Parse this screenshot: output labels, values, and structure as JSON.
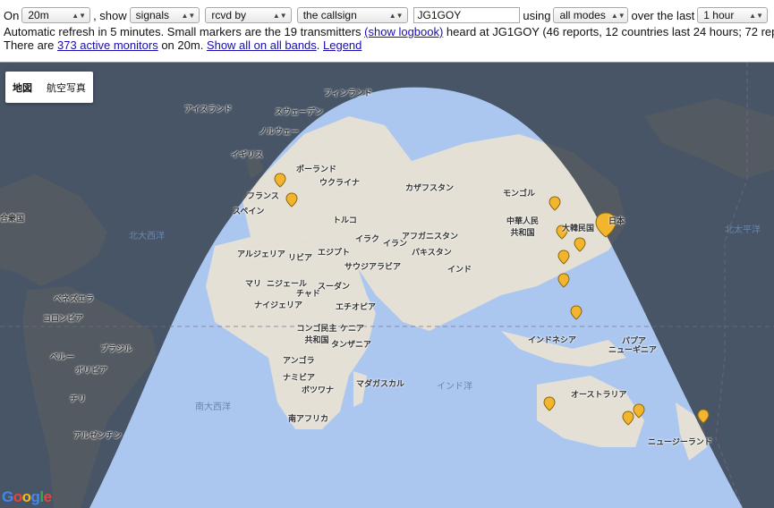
{
  "controls": {
    "on_label": "On",
    "band": "20m",
    "show_label": ", show",
    "show": "signals",
    "direction": "rcvd by",
    "target": "the callsign",
    "callsign": "JG1GOY",
    "using_label": "using",
    "modes": "all modes",
    "over_label": "over the last",
    "period": "1 hour"
  },
  "info": {
    "line2_pre": "Automatic refresh in 5 minutes. Small markers are the 19 transmitters ",
    "logbook_link": "(show logbook)",
    "line2_post": " heard at JG1GOY (46 reports, 12 countries last 24 hours; 72 reports,",
    "line3_pre": "There are ",
    "monitors_link": "373 active monitors",
    "line3_mid": " on 20m. ",
    "all_bands_link": "Show all on all bands",
    "line3_sep": ". ",
    "legend_link": "Legend"
  },
  "map": {
    "type_map": "地図",
    "type_satellite": "航空写真",
    "google": "Google",
    "colors": {
      "ocean": "#abc7f0",
      "land": "#e4e0d6",
      "night": "#2a3440",
      "night_land": "#3b4451",
      "marker": "#f3b52e",
      "marker_stroke": "#8a6a10"
    },
    "oceans": [
      "北大西洋",
      "北太平洋",
      "南大西洋",
      "インド洋"
    ],
    "countries": [
      "フィンランド",
      "スウェーデン",
      "アイスランド",
      "ノルウェー",
      "イギリス",
      "ポーランド",
      "ウクライナ",
      "フランス",
      "スペイン",
      "カザフスタン",
      "モンゴル",
      "トルコ",
      "中華人民共和国",
      "大韓民国",
      "日本",
      "アルジェリア",
      "リビア",
      "エジプト",
      "イラク",
      "イラン",
      "アフガニスタン",
      "パキスタン",
      "サウジアラビア",
      "インド",
      "マリ",
      "ニジェール",
      "チャド",
      "スーダン",
      "ナイジェリア",
      "エチオピア",
      "コンゴ民主共和国",
      "ケニア",
      "タンザニア",
      "インドネシア",
      "パプア",
      "ニューギニア",
      "ベネズエラ",
      "コロンビア",
      "ブラジル",
      "ペルー",
      "ボリビア",
      "チリ",
      "アルゼンチン",
      "アンゴラ",
      "ナミビア",
      "ボツワナ",
      "南アフリカ",
      "マダガスカル",
      "オーストラリア",
      "ニュージーランド",
      "合衆国"
    ]
  }
}
